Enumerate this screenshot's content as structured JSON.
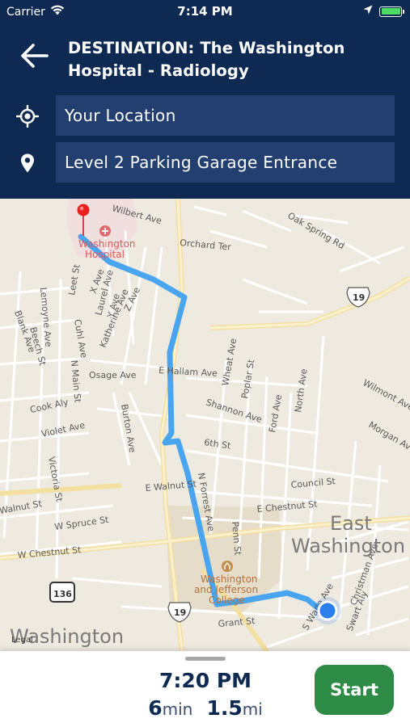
{
  "status_bar": {
    "carrier": "Carrier",
    "time": "7:14 PM"
  },
  "header": {
    "destination_prefix": "DESTINATION:",
    "destination_name": "The Washington Hospital - Radiology",
    "origin_field": "Your Location",
    "destination_field": "Level 2 Parking Garage Entrance"
  },
  "map": {
    "hospital_label": "Washington Hospital",
    "college_label": "Washington and Jefferson College",
    "town_label_east": "East Washington",
    "town_label": "Washington",
    "legal_label": "Legal",
    "route_shields": [
      "19",
      "19",
      "136"
    ],
    "streets": [
      "Wilbert Ave",
      "Orchard Ter",
      "Oak Spring Rd",
      "Leet St",
      "X Ave",
      "Laurel Ave",
      "Y Ave",
      "Z Ave",
      "Katherine Ave",
      "Lemoyne Ave",
      "Beech St",
      "Blank Ave",
      "Cuhl Ave",
      "N Main St",
      "Osage Ave",
      "E Hallam Ave",
      "Wheat Ave",
      "Poplar St",
      "Wilmont Ave",
      "Shannon Ave",
      "Cook Aly",
      "Violet Ave",
      "Burton Ave",
      "6th St",
      "North Ave",
      "Morgan Ave",
      "Victoria St",
      "Ford Ave",
      "Council St",
      "E Walnut St",
      "N Forrest Ave",
      "E Chestnut St",
      "W Spruce St",
      "Penn St",
      "W Chestnut St",
      "Christman Ave",
      "Swart Aly",
      "S Wade Ave",
      "Grant St",
      "Walnut St"
    ],
    "colors": {
      "route": "#4aa5f0",
      "land": "#eeeae0",
      "road": "#ffffff",
      "highway": "#f3dfa0",
      "campus": "#e5dcc9",
      "hospital_area": "#f1dede",
      "location_dot": "#2c7ee8"
    }
  },
  "trip": {
    "eta": "7:20 PM",
    "duration_value": "6",
    "duration_unit": "min",
    "distance_value": "1.5",
    "distance_unit": "mi",
    "start_label": "Start"
  },
  "colors": {
    "header_bg": "#0f2a52",
    "field_bg": "#223f6f",
    "start_button": "#2e8b45"
  }
}
